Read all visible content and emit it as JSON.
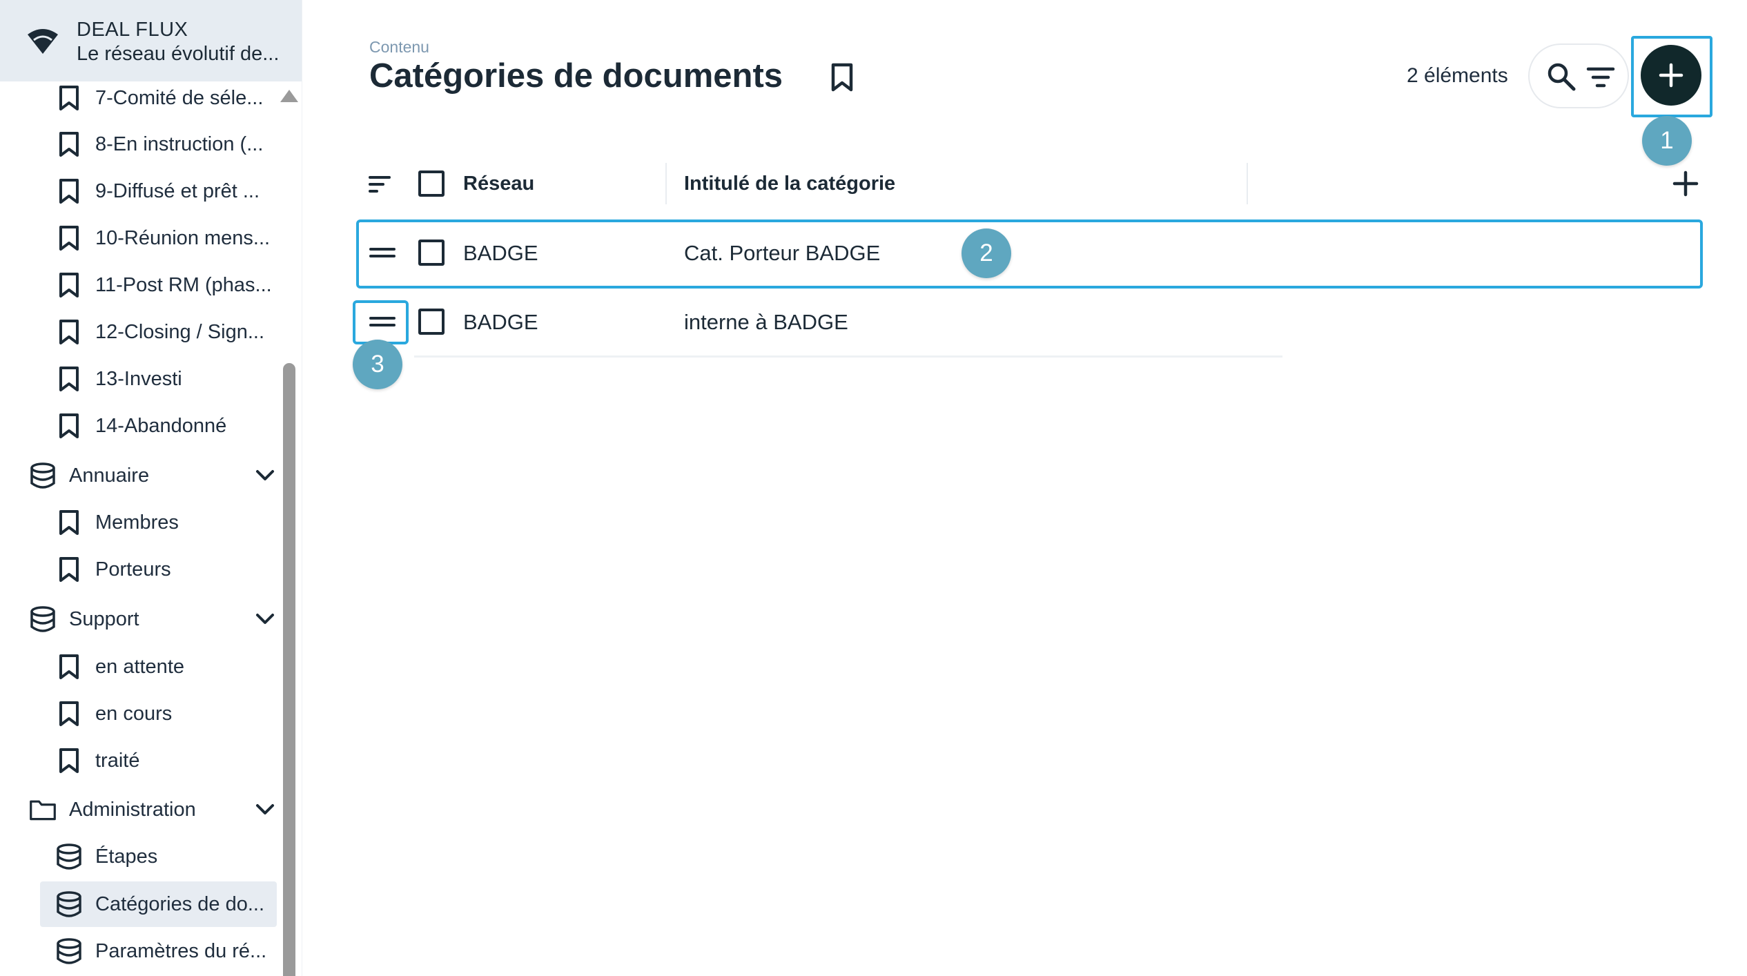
{
  "app": {
    "name": "DEAL FLUX",
    "subtitle": "Le réseau évolutif de..."
  },
  "sidebar": {
    "pipeline_items": [
      {
        "label": "7-Comité de séle..."
      },
      {
        "label": "8-En instruction (..."
      },
      {
        "label": "9-Diffusé et prêt ..."
      },
      {
        "label": "10-Réunion mens..."
      },
      {
        "label": "11-Post RM (phas..."
      },
      {
        "label": "12-Closing / Sign..."
      },
      {
        "label": "13-Investi"
      },
      {
        "label": "14-Abandonné"
      }
    ],
    "annuaire": {
      "label": "Annuaire",
      "items": [
        {
          "label": "Membres"
        },
        {
          "label": "Porteurs"
        }
      ]
    },
    "support": {
      "label": "Support",
      "items": [
        {
          "label": "en attente"
        },
        {
          "label": "en cours"
        },
        {
          "label": "traité"
        }
      ]
    },
    "administration": {
      "label": "Administration",
      "items": [
        {
          "label": "Étapes"
        },
        {
          "label": "Catégories de do..."
        },
        {
          "label": "Paramètres du ré..."
        }
      ]
    }
  },
  "page": {
    "breadcrumb": "Contenu",
    "title": "Catégories de documents",
    "count": "2 éléments"
  },
  "table": {
    "columns": [
      "Réseau",
      "Intitulé de la catégorie"
    ],
    "rows": [
      {
        "reseau": "BADGE",
        "intitule": "Cat. Porteur BADGE"
      },
      {
        "reseau": "BADGE",
        "intitule": "interne à BADGE"
      }
    ]
  },
  "annotations": [
    "1",
    "2",
    "3"
  ],
  "colors": {
    "highlight": "#2aa8de",
    "badge": "#5fa7c0",
    "primary_button": "#11282b",
    "sidebar_header": "#e6ecf2"
  },
  "icons": {
    "logo": "wifi-logo-icon",
    "bookmark": "bookmark-icon",
    "database": "database-icon",
    "folder": "folder-icon",
    "search": "search-icon",
    "filter": "filter-icon",
    "add": "plus-icon",
    "sort": "sort-icon",
    "drag": "drag-handle-icon"
  }
}
